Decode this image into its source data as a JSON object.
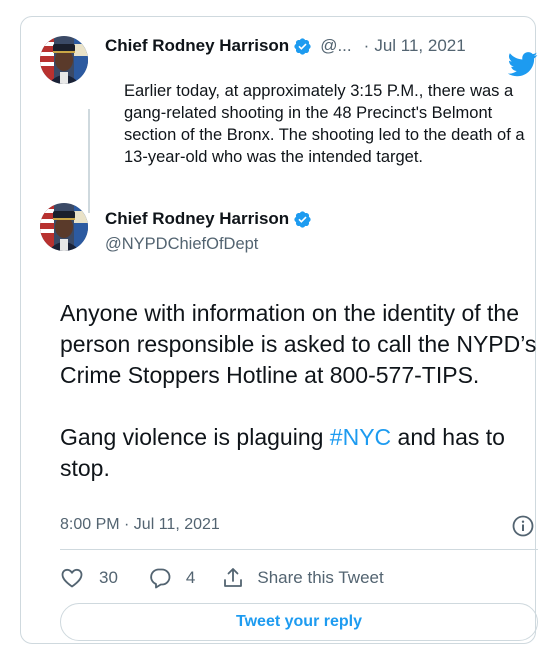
{
  "quoted_tweet": {
    "author_name": "Chief Rodney Harrison",
    "handle_truncated": "@...",
    "separator": "·",
    "date": "Jul 11, 2021",
    "text": "Earlier today, at approximately 3:15 P.M., there was a gang-related shooting in the 48 Precinct's Belmont section of the Bronx. The shooting led to the death of a 13-year-old who was the intended target."
  },
  "main_tweet": {
    "author_name": "Chief Rodney Harrison",
    "handle": "@NYPDChiefOfDept",
    "paragraph1": "Anyone with information on the identity of the person responsible is asked to call the NYPD’s Crime Stoppers Hotline at 800-577-TIPS.",
    "paragraph2_before": "Gang violence is plaguing ",
    "hashtag": "#NYC",
    "paragraph2_after": " and has to stop.",
    "timestamp": "8:00 PM · Jul 11, 2021"
  },
  "actions": {
    "likes": "30",
    "replies": "4",
    "share_label": "Share this Tweet"
  },
  "reply_button_label": "Tweet your reply",
  "colors": {
    "accent": "#1d9bf0",
    "text": "#0f1419",
    "muted": "#536471",
    "border": "#cfd9de"
  },
  "icons": {
    "brand": "twitter-bird-icon",
    "verified": "verified-badge-icon",
    "info": "info-icon",
    "like": "heart-icon",
    "reply": "speech-bubble-icon",
    "share": "share-icon"
  }
}
